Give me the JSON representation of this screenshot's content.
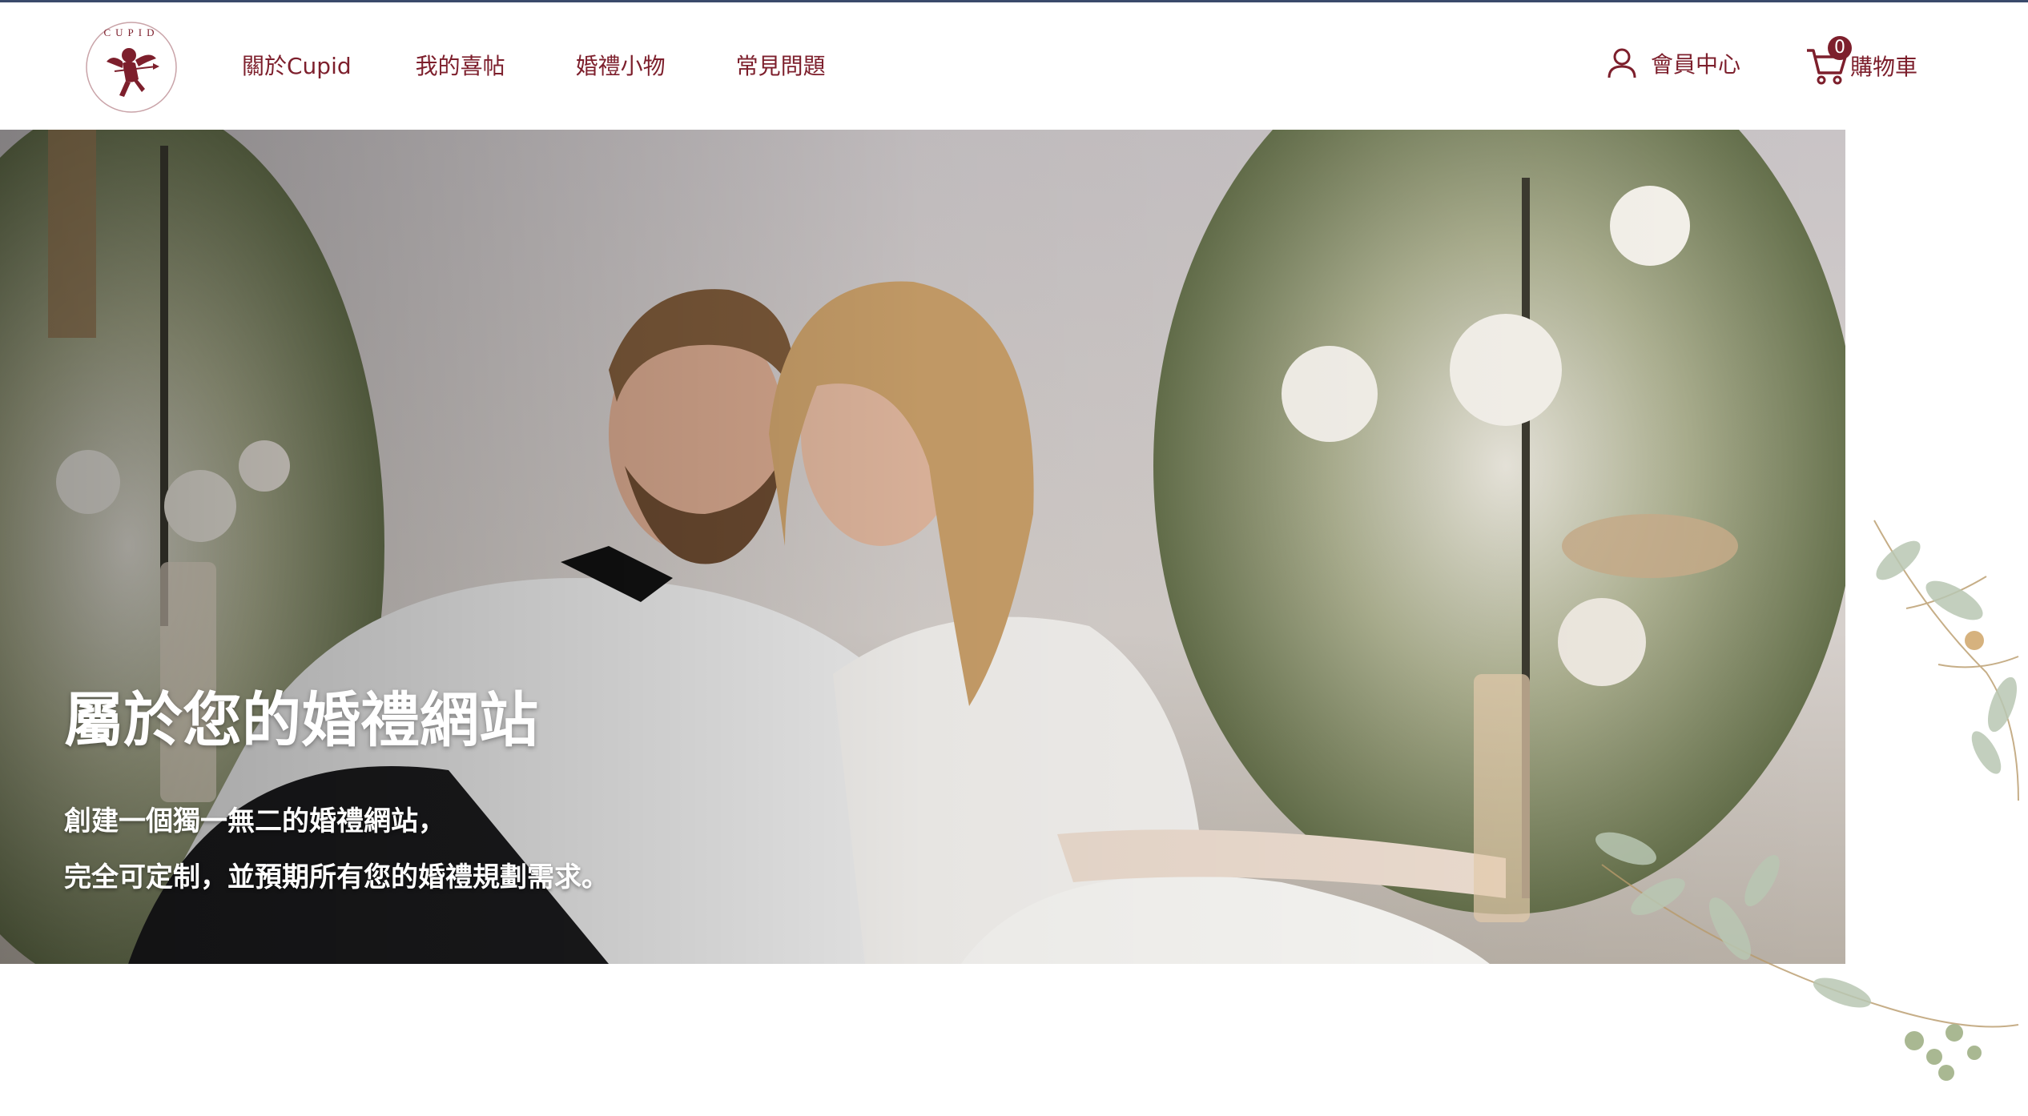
{
  "brand": {
    "logo_text": "CUPID",
    "logo_icon": "cupid-logo"
  },
  "nav": {
    "items": [
      {
        "label": "關於Cupid"
      },
      {
        "label": "我的喜帖"
      },
      {
        "label": "婚禮小物"
      },
      {
        "label": "常見問題"
      }
    ]
  },
  "account": {
    "label": "會員中心",
    "icon": "user-icon"
  },
  "cart": {
    "label": "購物車",
    "count": "0",
    "icon": "cart-icon"
  },
  "hero": {
    "title": "屬於您的婚禮網站",
    "subtitle_line1": "創建一個獨一無二的婚禮網站，",
    "subtitle_line2": "完全可定制，並預期所有您的婚禮規劃需求。"
  },
  "colors": {
    "brand": "#7d1f2c",
    "accent_top": "#3a4a6b",
    "background": "#ffffff"
  }
}
